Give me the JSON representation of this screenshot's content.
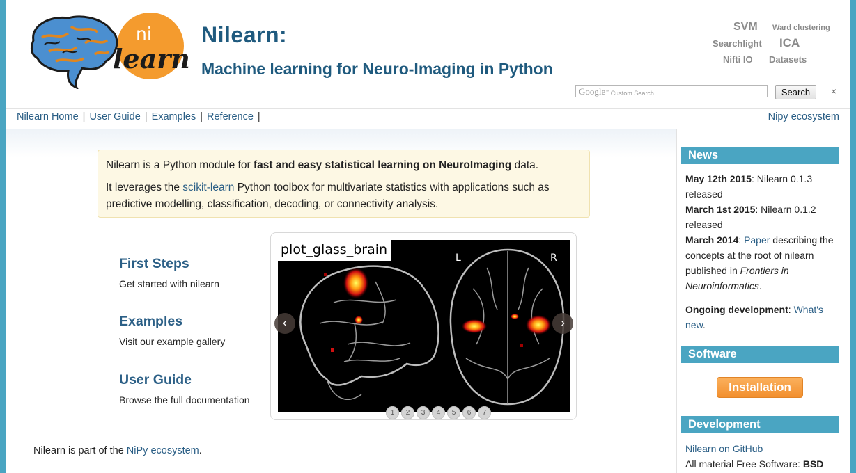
{
  "header": {
    "logo_text_top": "ni",
    "logo_text_bottom": "learn",
    "title": "Nilearn:",
    "subtitle": "Machine learning for Neuro-Imaging in Python",
    "quick_links": [
      "SVM",
      "Ward clustering",
      "Searchlight",
      "ICA",
      "Nifti IO",
      "Datasets"
    ],
    "search": {
      "brand": "Google",
      "tm": "™",
      "placeholder": "Custom Search",
      "button_label": "Search",
      "clear": "×"
    }
  },
  "nav": {
    "items": [
      "Nilearn Home",
      "User Guide",
      "Examples",
      "Reference"
    ],
    "separator": "|",
    "right_link": "Nipy ecosystem"
  },
  "intro": {
    "line1_pre": "Nilearn is a Python module for ",
    "line1_bold": "fast and easy statistical learning on NeuroImaging",
    "line1_post": " data.",
    "line2_pre": "It leverages the ",
    "line2_link": "scikit-learn",
    "line2_post": " Python toolbox for multivariate statistics with applications such as predictive modelling, classification, decoding, or connectivity analysis."
  },
  "features": [
    {
      "title": "First Steps",
      "desc": "Get started with nilearn"
    },
    {
      "title": "Examples",
      "desc": "Visit our example gallery"
    },
    {
      "title": "User Guide",
      "desc": "Browse the full documentation"
    }
  ],
  "carousel": {
    "caption": "plot_glass_brain",
    "left_label": "L",
    "right_label": "R",
    "prev": "‹",
    "next": "›",
    "pages": [
      "1",
      "2",
      "3",
      "4",
      "5",
      "6",
      "7"
    ]
  },
  "footer_note": {
    "pre": "Nilearn is part of the ",
    "link": "NiPy ecosystem",
    "post": "."
  },
  "sidebar": {
    "news_title": "News",
    "news": [
      {
        "date": "May 12th 2015",
        "text": ": Nilearn 0.1.3 released"
      },
      {
        "date": "March 1st 2015",
        "text": ": Nilearn 0.1.2 released"
      },
      {
        "date": "March 2014",
        "text": ": ",
        "link": "Paper",
        "text2": " describing the concepts at the root of nilearn published in ",
        "italic": "Frontiers in Neuroinformatics",
        "text3": "."
      }
    ],
    "ongoing_bold": "Ongoing development",
    "ongoing_sep": ": ",
    "ongoing_link": "What's new",
    "ongoing_post": ".",
    "software_title": "Software",
    "install_label": "Installation",
    "development_title": "Development",
    "github_link": "Nilearn on GitHub",
    "license_pre": "All material Free Software: ",
    "license_bold": "BSD"
  }
}
